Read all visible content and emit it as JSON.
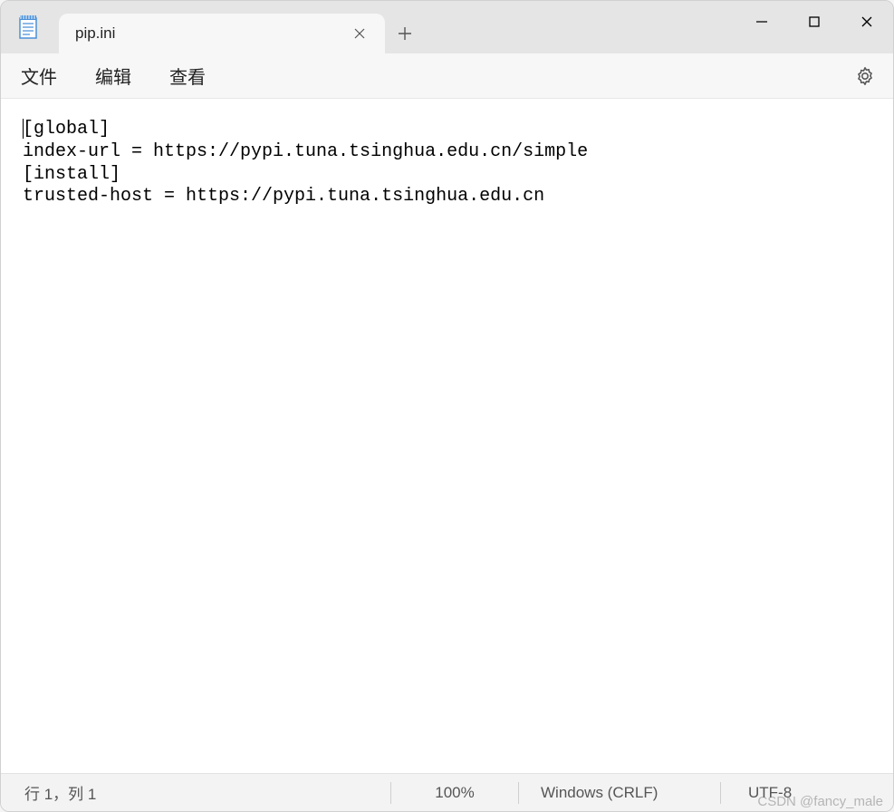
{
  "tab": {
    "title": "pip.ini"
  },
  "menu": {
    "file": "文件",
    "edit": "编辑",
    "view": "查看"
  },
  "editor": {
    "content": "[global]\nindex-url = https://pypi.tuna.tsinghua.edu.cn/simple\n[install]\ntrusted-host = https://pypi.tuna.tsinghua.edu.cn"
  },
  "status": {
    "position": "行 1，列 1",
    "zoom": "100%",
    "line_ending": "Windows (CRLF)",
    "encoding": "UTF-8"
  },
  "watermark": "CSDN @fancy_male"
}
